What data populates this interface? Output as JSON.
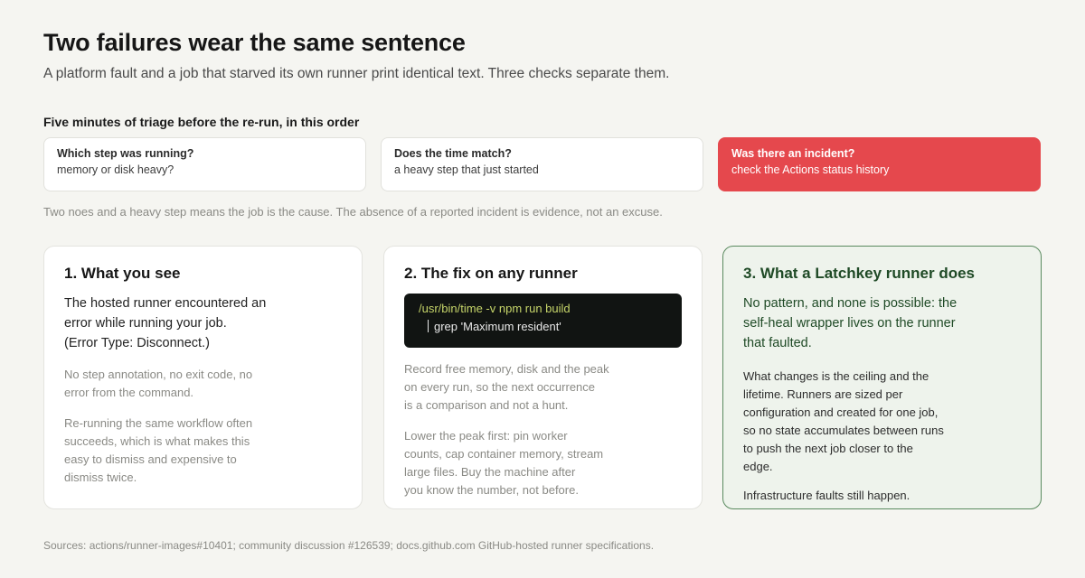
{
  "header": {
    "title": "Two failures wear the same sentence",
    "subtitle": "A platform fault and a job that starved its own runner print identical text. Three checks separate them."
  },
  "triage": {
    "heading": "Five minutes of triage before the re-run, in this order",
    "checks": [
      {
        "question": "Which step was running?",
        "answer": "memory or disk heavy?"
      },
      {
        "question": "Does the time match?",
        "answer": "a heavy step that just started"
      },
      {
        "question": "Was there an incident?",
        "answer": "check the Actions status history"
      }
    ],
    "note": "Two noes and a heavy step means the job is the cause. The absence of a reported incident is evidence, not an excuse."
  },
  "cards": [
    {
      "title": "1. What you see",
      "lead": [
        "The hosted runner encountered an",
        "error while running your job.",
        "(Error Type: Disconnect.)"
      ],
      "para1": [
        "No step annotation, no exit code, no",
        "error from the command."
      ],
      "para2": [
        "Re-running the same workflow often",
        "succeeds, which is what makes this",
        "easy to dismiss and expensive to",
        "dismiss twice."
      ]
    },
    {
      "title": "2. The fix on any runner",
      "code": {
        "line1": "/usr/bin/time -v npm run build",
        "line2": "grep 'Maximum resident'"
      },
      "para1": [
        "Record free memory, disk and the peak",
        "on every run, so the next occurrence",
        "is a comparison and not a hunt."
      ],
      "para2": [
        "Lower the peak first: pin worker",
        "counts, cap container memory, stream",
        "large files. Buy the machine after",
        "you know the number, not before."
      ]
    },
    {
      "title": "3. What a Latchkey runner does",
      "lead": [
        "No pattern, and none is possible: the",
        "self-heal wrapper lives on the runner",
        "that faulted."
      ],
      "para1": [
        "What changes is the ceiling and the",
        "lifetime. Runners are sized per",
        "configuration and created for one job,",
        "so no state accumulates between runs",
        "to push the next job closer to the",
        "edge."
      ],
      "para2": [
        "Infrastructure faults still happen."
      ]
    }
  ],
  "sources": "Sources: actions/runner-images#10401; community discussion #126539; docs.github.com GitHub-hosted runner specifications.",
  "colors": {
    "alert": "#e5484d",
    "accent_green": "#1f4a26",
    "code_bg": "#111412"
  }
}
